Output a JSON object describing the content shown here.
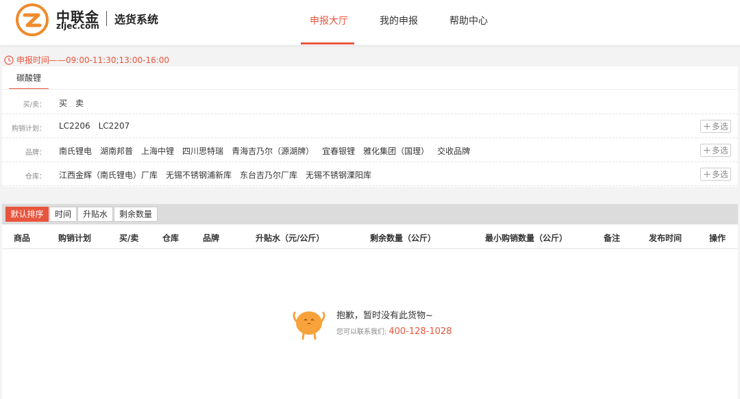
{
  "brand": {
    "name": "中联金",
    "url": "zljec.com",
    "system": "选货系统"
  },
  "nav": {
    "items": [
      {
        "label": "申报大厅"
      },
      {
        "label": "我的申报"
      },
      {
        "label": "帮助中心"
      }
    ]
  },
  "declare_time": "申报时间——09:00-11:30;13:00-16:00",
  "product_tab": "碳酸锂",
  "filters": {
    "buy_sell": {
      "label": "买/卖：",
      "options": [
        "买",
        "卖"
      ]
    },
    "plan": {
      "label": "购销计划：",
      "options": [
        "LC2206",
        "LC2207"
      ]
    },
    "brand": {
      "label": "品牌：",
      "options": [
        "南氏锂电",
        "湖南邦普",
        "上海中锂",
        "四川思特瑞",
        "青海吉乃尔（源湖牌）",
        "宜春银锂",
        "雅化集团（国理）",
        "交收品牌"
      ]
    },
    "warehouse": {
      "label": "仓库：",
      "options": [
        "江西金辉（南氏锂电）厂库",
        "无锡不锈钢浦新库",
        "东台吉乃尔厂库",
        "无锡不锈钢溧阳库"
      ]
    },
    "multi_select": "多选"
  },
  "sort": {
    "buttons": [
      "默认排序",
      "时间",
      "升贴水",
      "剩余数量"
    ]
  },
  "table": {
    "columns": [
      "商品",
      "购销计划",
      "买/卖",
      "仓库",
      "品牌",
      "升贴水（元/公斤）",
      "剩余数量（公斤）",
      "最小购销数量（公斤）",
      "备注",
      "发布时间",
      "操作"
    ]
  },
  "empty": {
    "title": "抱歉，暂时没有此货物~",
    "contact_label": "您可以联系我们:",
    "phone": "400-128-1028"
  },
  "colors": {
    "accent": "#e8553d",
    "logo_orange": "#f08a2c",
    "mascot": "#f7a23a"
  }
}
